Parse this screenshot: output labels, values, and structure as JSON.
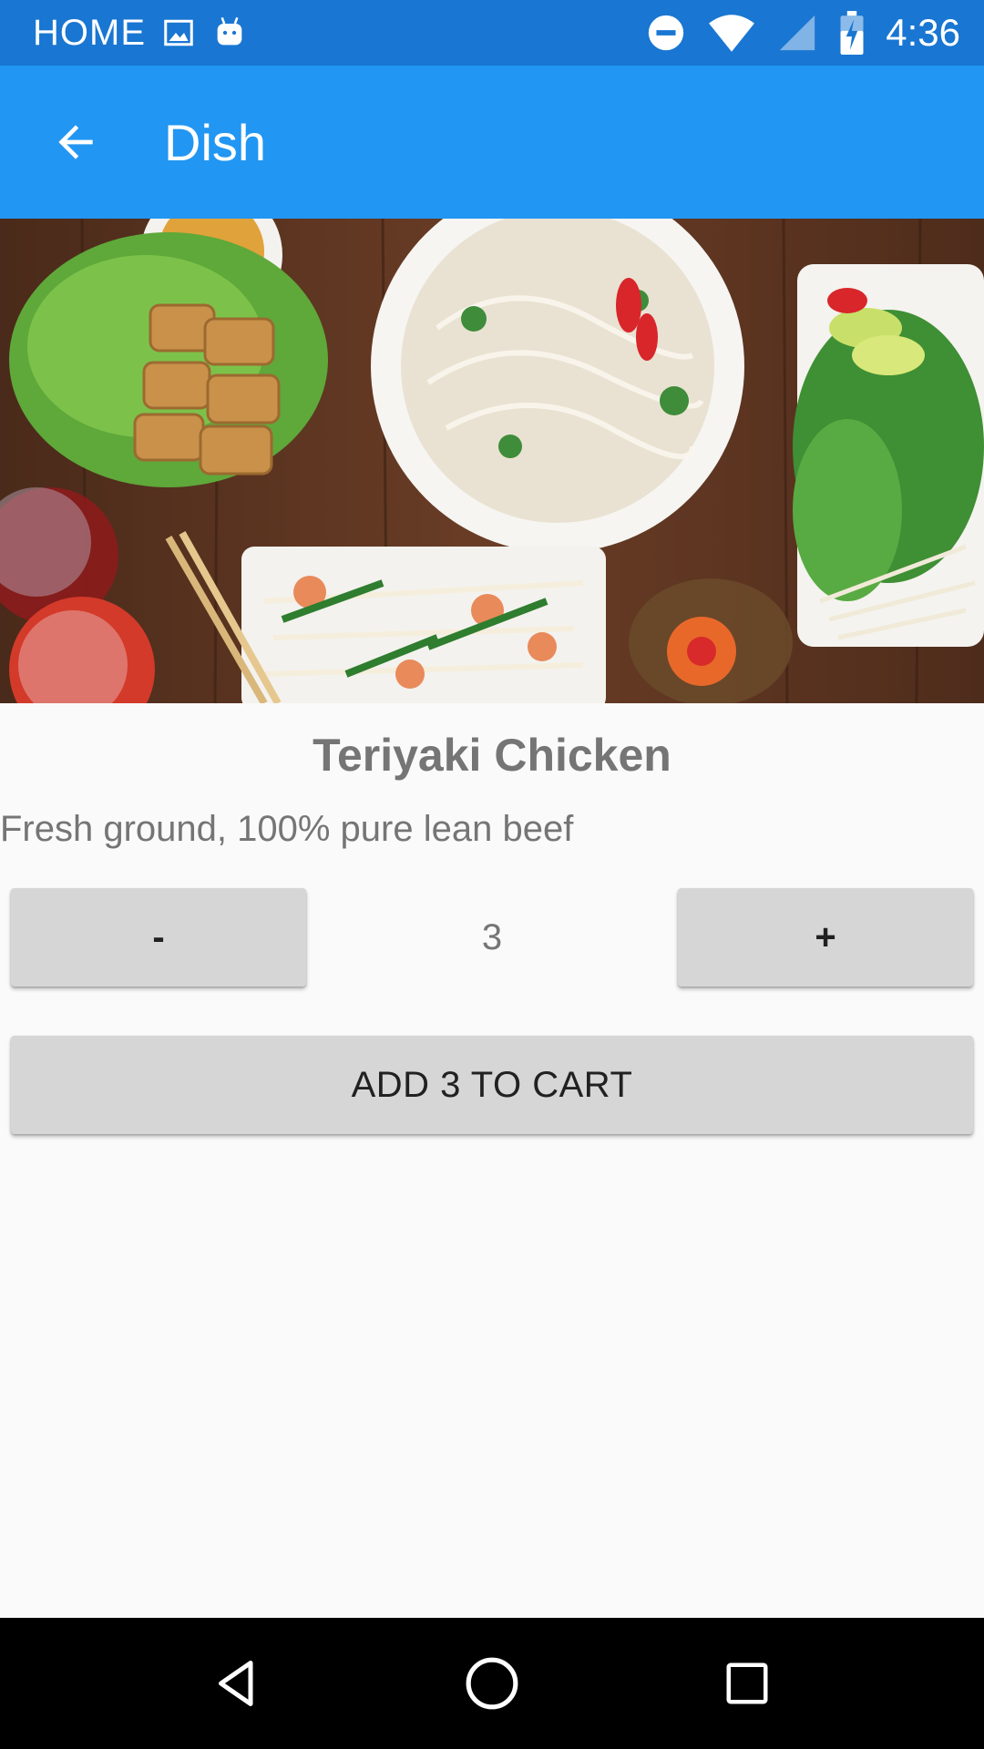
{
  "status_bar": {
    "home_label": "HOME",
    "time": "4:36",
    "icons": [
      "image-icon",
      "android-icon",
      "do-not-disturb-icon",
      "wifi-icon",
      "signal-icon",
      "battery-charging-icon"
    ]
  },
  "app_bar": {
    "title": "Dish",
    "back_icon": "arrow-back-icon"
  },
  "dish": {
    "name": "Teriyaki Chicken",
    "description": "Fresh ground, 100% pure lean beef"
  },
  "quantity_control": {
    "minus_label": "-",
    "value": "3",
    "plus_label": "+"
  },
  "cart": {
    "add_label": "ADD 3 TO CART"
  },
  "nav_bar": {
    "icons": [
      "back-triangle-icon",
      "home-circle-icon",
      "recents-square-icon"
    ]
  },
  "colors": {
    "status_bar": "#1976d2",
    "app_bar": "#2196f3",
    "background": "#fafafa",
    "button": "#d6d6d6",
    "muted_text": "#757575"
  }
}
